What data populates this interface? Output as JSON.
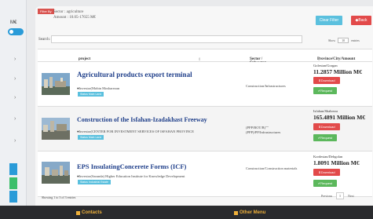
{
  "rail": {
    "label": "M€",
    "chevrons": [
      "›",
      "›",
      "›",
      "›",
      "›"
    ],
    "colors": [
      "#2a9bd8",
      "#3bbf6a",
      "#2a9bd8"
    ]
  },
  "filter": {
    "badge": "Filter By",
    "line1": "Sector : agriculture",
    "line2": "Amount : 10.05-17655 M€"
  },
  "buttons": {
    "clear_filter": "Clear Filter",
    "back": "◆Back"
  },
  "search": {
    "label": "Search:",
    "value": ""
  },
  "show": {
    "prefix": "Show",
    "value": "10",
    "suffix": "entries"
  },
  "table": {
    "headers": {
      "project": "project",
      "sector": "Sector / Subsector",
      "prov": "Province/City/Amount",
      "sort": "⇕"
    },
    "rows": [
      {
        "title": "Agricultural products export terminal",
        "investor": "Investor(Mobin Mosbarezan",
        "tag": "Status Main Land",
        "sector": "Construction/Infrastructures",
        "province": "Golestan/Gorgan",
        "amount": "11.2857 Million M€",
        "download": "⬇Download",
        "request": "✔Request"
      },
      {
        "title": "Construction of the Isfahan-Izadakhast Freeway",
        "investor": "Investor(CENTER FOR INVESTMENT SERVICES OF ISFAHAN PROVINCE",
        "tag": "Status Main Land",
        "sector": "(PPP/BOT/B)\"\"(PPP)/PP/Infrastructures",
        "province": "Isfahan/Shahreza",
        "amount": "165.4891 Million M€",
        "download": "⬇Download",
        "request": "✔Request"
      },
      {
        "title": "EPS InsulatingConcerete Forms (ICF)",
        "investor": "Investor(Saranda) Higher Education Institute for Knowledge Development",
        "tag": "Status Industrial Estate",
        "sector": "Construction/Construction materials",
        "province": "Kordestan/Dehgolan",
        "amount": "1.8091 Million M€",
        "download": "⬇Download",
        "request": "✔Request"
      }
    ]
  },
  "footer": {
    "info": "Showing 1 to 3 of 3 entries",
    "previous": "Previous",
    "page": "1",
    "next": "Next"
  },
  "bottom": {
    "contacts": "Contacts",
    "other_menu": "Other Menu"
  }
}
